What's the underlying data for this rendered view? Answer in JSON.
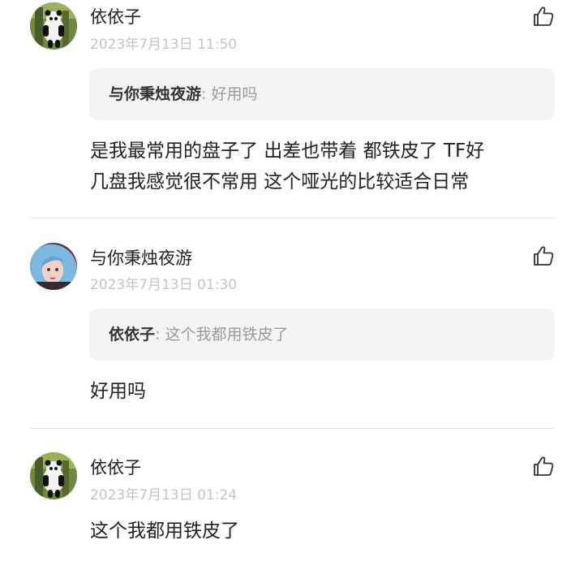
{
  "comments": [
    {
      "author": "依依子",
      "time": "2023年7月13日 11:50",
      "avatar_icon": "panda-avatar",
      "quote": {
        "author": "与你秉烛夜游",
        "sep": ": ",
        "text": "好用吗"
      },
      "text_lines": [
        "是我最常用的盘子了 出差也带着 都铁皮了 TF好",
        "几盘我感觉很不常用 这个哑光的比较适合日常"
      ]
    },
    {
      "author": "与你秉烛夜游",
      "time": "2023年7月13日 01:30",
      "avatar_icon": "anime-girl-avatar",
      "quote": {
        "author": "依依子",
        "sep": ": ",
        "text": "这个我都用铁皮了"
      },
      "text_lines": [
        "好用吗"
      ]
    },
    {
      "author": "依依子",
      "time": "2023年7月13日 01:24",
      "avatar_icon": "panda-avatar",
      "text_lines": [
        "这个我都用铁皮了"
      ]
    }
  ],
  "icons": {
    "like": "thumbs-up-icon"
  },
  "colors": {
    "quote_bg": "#f4f4f4",
    "time": "#c4c4c4",
    "divider": "#e8e8e8"
  }
}
